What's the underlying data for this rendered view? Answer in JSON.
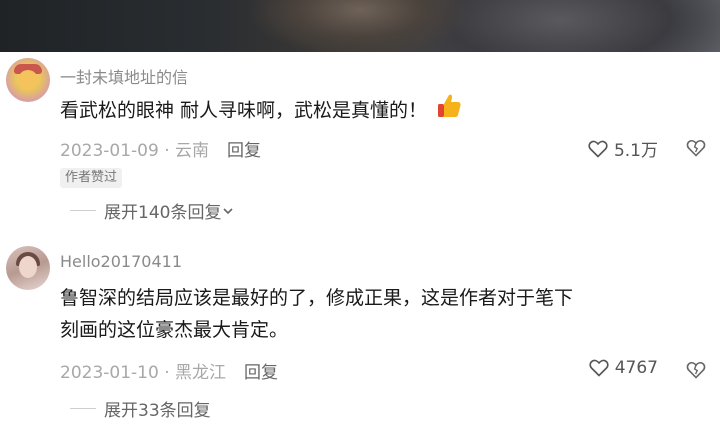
{
  "comments": [
    {
      "username": "一封未填地址的信",
      "text": "看武松的眼神 耐人寻味啊，武松是真懂的！",
      "date": "2023-01-09",
      "location": "云南",
      "reply_label": "回复",
      "likes": "5.1万",
      "badge": "作者赞过",
      "expand_label": "展开140条回复",
      "emoji_icon": "thumbs-up-icon"
    },
    {
      "username": "Hello20170411",
      "text_line1": "鲁智深的结局应该是最好的了，修成正果，这是作者对于笔下",
      "text_line2": "刻画的这位豪杰最大肯定。",
      "date": "2023-01-10",
      "location": "黑龙江",
      "reply_label": "回复",
      "likes": "4767",
      "expand_label": "展开33条回复"
    }
  ],
  "colors": {
    "meta_gray": "#a8a8a8",
    "text": "#1a1a1a",
    "username": "#8a8a8a"
  }
}
